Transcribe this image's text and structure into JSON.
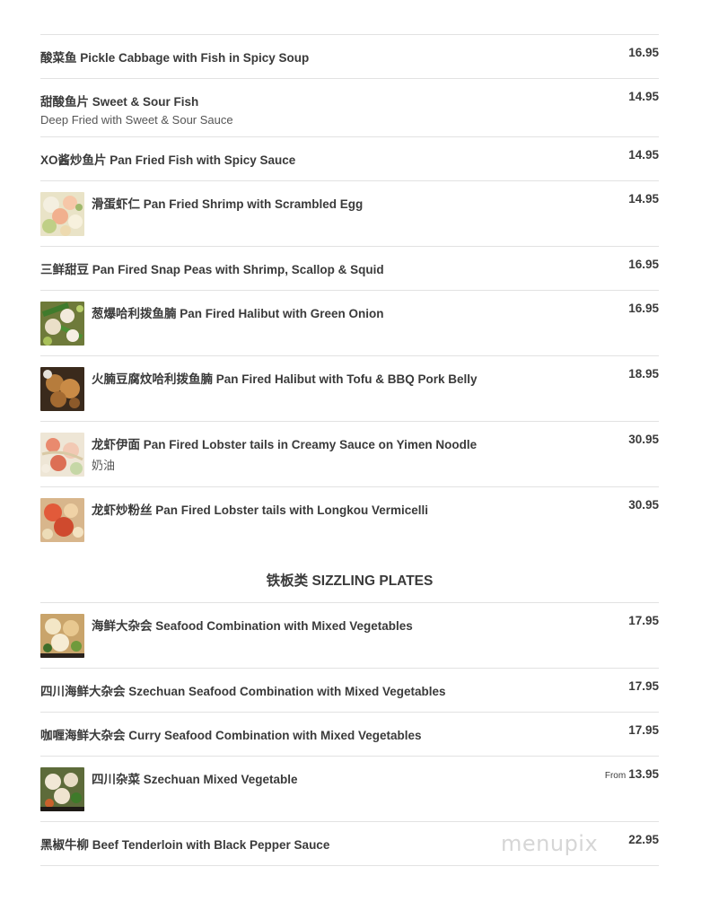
{
  "items": [
    {
      "name": "酸菜鱼 Pickle Cabbage with Fish in Spicy Soup",
      "price": "16.95"
    },
    {
      "name": "甜酸鱼片 Sweet & Sour Fish",
      "description": "Deep Fried with Sweet & Sour Sauce",
      "price": "14.95"
    },
    {
      "name": "XO酱炒鱼片 Pan Fried Fish with Spicy Sauce",
      "price": "14.95"
    },
    {
      "name": "滑蛋虾仁 Pan Fried Shrimp with Scrambled Egg",
      "price": "14.95",
      "photo": "shrimp-egg-photo"
    },
    {
      "name": "三鲜甜豆 Pan Fired Snap Peas with Shrimp, Scallop & Squid",
      "price": "16.95"
    },
    {
      "name": "葱爆哈利拨鱼腩 Pan Fired Halibut with Green Onion",
      "price": "16.95",
      "photo": "halibut-onion-photo"
    },
    {
      "name": "火腩豆腐炆哈利拨鱼腩 Pan Fired Halibut with Tofu & BBQ Pork Belly",
      "price": "18.95",
      "photo": "halibut-tofu-photo"
    },
    {
      "name": "龙虾伊面 Pan Fired Lobster tails in Creamy Sauce on Yimen Noodle",
      "description": "奶油",
      "price": "30.95",
      "photo": "lobster-noodle-photo"
    },
    {
      "name": "龙虾炒粉丝 Pan Fired Lobster tails with Longkou Vermicelli",
      "price": "30.95",
      "photo": "lobster-vermicelli-photo"
    }
  ],
  "section": {
    "title": "铁板类 SIZZLING PLATES"
  },
  "sizzling_items": [
    {
      "name": "海鲜大杂会 Seafood Combination with Mixed Vegetables",
      "price": "17.95",
      "photo": "seafood-combo-photo"
    },
    {
      "name": "四川海鲜大杂会 Szechuan Seafood Combination with Mixed Vegetables",
      "price": "17.95"
    },
    {
      "name": "咖喱海鲜大杂会 Curry Seafood Combination with Mixed Vegetables",
      "price": "17.95"
    },
    {
      "name": "四川杂菜 Szechuan Mixed Vegetable",
      "price_prefix": "From",
      "price": "13.95",
      "photo": "mixed-vegetable-photo"
    },
    {
      "name": "黑椒牛柳 Beef Tenderloin with Black Pepper Sauce",
      "price": "22.95"
    }
  ],
  "watermark": "menupix"
}
